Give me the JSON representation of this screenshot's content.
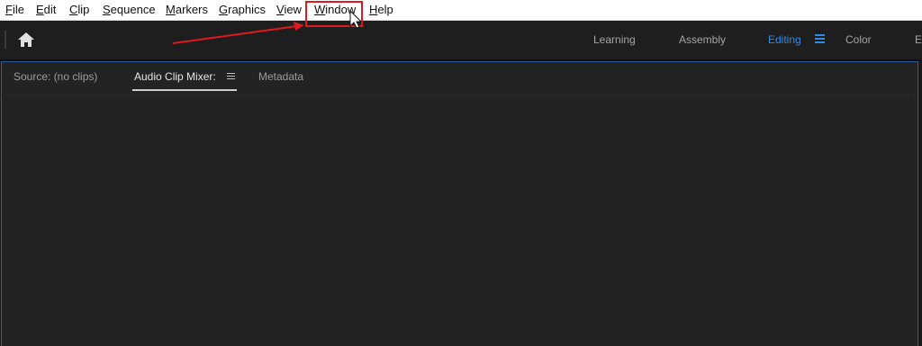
{
  "menubar": {
    "items": [
      {
        "label_u": "F",
        "label_rest": "ile"
      },
      {
        "label_u": "E",
        "label_rest": "dit"
      },
      {
        "label_u": "C",
        "label_rest": "lip"
      },
      {
        "label_u": "S",
        "label_rest": "equence"
      },
      {
        "label_u": "M",
        "label_rest": "arkers"
      },
      {
        "label_u": "G",
        "label_rest": "raphics"
      },
      {
        "label_u": "V",
        "label_rest": "iew"
      },
      {
        "label_u": "W",
        "label_rest": "indow"
      },
      {
        "label_u": "H",
        "label_rest": "elp"
      }
    ]
  },
  "workspace": {
    "home_icon": "home-icon",
    "tabs": [
      "Learning",
      "Assembly",
      "Editing",
      "Color",
      "E"
    ],
    "active_tab": "Editing",
    "active_color": "#2d8ceb"
  },
  "panel": {
    "tabs": [
      "Source: (no clips)",
      "Audio Clip Mixer:",
      "Metadata"
    ],
    "active_tab": "Audio Clip Mixer:",
    "border_color": "#2e5a9e"
  },
  "annotation": {
    "highlight_color": "#e0191f",
    "highlighted_item": "Window"
  }
}
